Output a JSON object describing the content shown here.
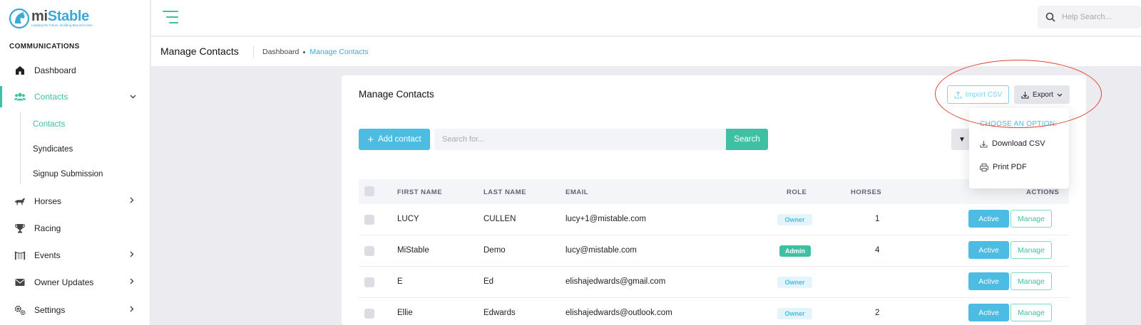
{
  "brand": {
    "name_part1": "mi",
    "name_part2": "Stable",
    "tagline": "Leading the Future, Building Beyond Limits"
  },
  "sidebar": {
    "section": "COMMUNICATIONS",
    "items": [
      {
        "label": "Dashboard",
        "icon": "home-icon"
      },
      {
        "label": "Contacts",
        "icon": "users-icon"
      },
      {
        "label": "Horses",
        "icon": "horse-icon"
      },
      {
        "label": "Racing",
        "icon": "trophy-icon"
      },
      {
        "label": "Events",
        "icon": "gate-icon"
      },
      {
        "label": "Owner Updates",
        "icon": "envelope-icon"
      },
      {
        "label": "Settings",
        "icon": "gears-icon"
      }
    ],
    "contacts_sub": [
      "Contacts",
      "Syndicates",
      "Signup Submission"
    ]
  },
  "topbar": {
    "help_placeholder": "Help Search..."
  },
  "subheader": {
    "title": "Manage Contacts",
    "breadcrumb": [
      "Dashboard",
      "Manage Contacts"
    ]
  },
  "card": {
    "title": "Manage Contacts",
    "import_label": "Import CSV",
    "export_label": "Export",
    "add_label": "Add contact",
    "search_placeholder": "Search for...",
    "search_label": "Search"
  },
  "table": {
    "headers": [
      "FIRST NAME",
      "LAST NAME",
      "EMAIL",
      "ROLE",
      "HORSES",
      "ACTIONS"
    ],
    "rows": [
      {
        "first": "LUCY",
        "last": "CULLEN",
        "email": "lucy+1@mistable.com",
        "role": "Owner",
        "horses": "1",
        "status": "Active",
        "action": "Manage"
      },
      {
        "first": "MiStable",
        "last": "Demo",
        "email": "lucy@mistable.com",
        "role": "Admin",
        "horses": "4",
        "status": "Active",
        "action": "Manage"
      },
      {
        "first": "E",
        "last": "Ed",
        "email": "elishajedwards@gmail.com",
        "role": "Owner",
        "horses": "",
        "status": "Active",
        "action": "Manage"
      },
      {
        "first": "Ellie",
        "last": "Edwards",
        "email": "elishajedwards@outlook.com",
        "role": "Owner",
        "horses": "2",
        "status": "Active",
        "action": "Manage"
      }
    ]
  },
  "export_menu": {
    "heading": "CHOOSE AN OPTION:",
    "items": [
      {
        "label": "Download CSV",
        "icon": "download-icon"
      },
      {
        "label": "Print PDF",
        "icon": "printer-icon"
      }
    ]
  },
  "colors": {
    "accent_green": "#3ec1a2",
    "accent_blue": "#4cbce2",
    "annotation_red": "#e0452f"
  }
}
